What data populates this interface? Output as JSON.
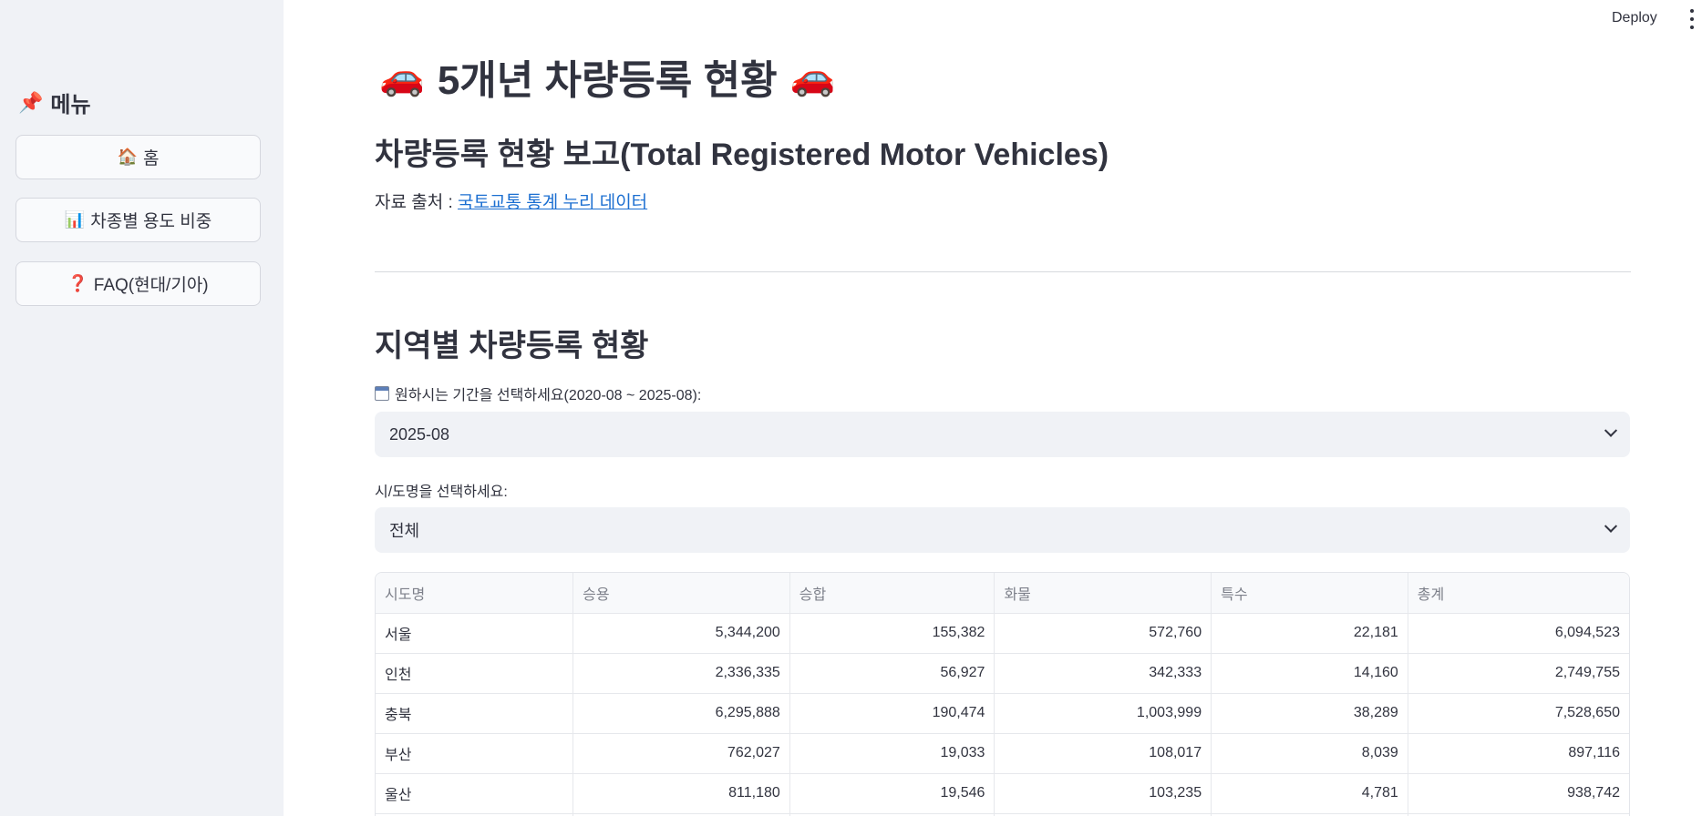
{
  "sidebar": {
    "title": "메뉴",
    "title_icon": "📌",
    "items": [
      {
        "icon": "🏠",
        "label": "홈"
      },
      {
        "icon": "📊",
        "label": "차종별 용도 비중"
      },
      {
        "icon": "❓",
        "label": "FAQ(현대/기아)"
      }
    ]
  },
  "header": {
    "deploy_label": "Deploy"
  },
  "main": {
    "title": "5개년 차량등록 현황",
    "title_icon": "🚗",
    "subtitle": "차량등록 현황 보고(Total Registered Motor Vehicles)",
    "source_prefix": "자료 출처 : ",
    "source_link": "국토교통 통계 누리 데이터",
    "section_title": "지역별 차량등록 현황",
    "period_label": "원하시는 기간을 선택하세요(2020-08 ~ 2025-08):",
    "period_value": "2025-08",
    "region_label": "시/도명을 선택하세요:",
    "region_value": "전체"
  },
  "table": {
    "columns": [
      "시도명",
      "승용",
      "승합",
      "화물",
      "특수",
      "총계"
    ],
    "rows": [
      [
        "서울",
        "5,344,200",
        "155,382",
        "572,760",
        "22,181",
        "6,094,523"
      ],
      [
        "인천",
        "2,336,335",
        "56,927",
        "342,333",
        "14,160",
        "2,749,755"
      ],
      [
        "충북",
        "6,295,888",
        "190,474",
        "1,003,999",
        "38,289",
        "7,528,650"
      ],
      [
        "부산",
        "762,027",
        "19,033",
        "108,017",
        "8,039",
        "897,116"
      ],
      [
        "울산",
        "811,180",
        "19,546",
        "103,235",
        "4,781",
        "938,742"
      ],
      [
        "",
        "",
        "",
        "",
        "",
        ""
      ]
    ]
  }
}
